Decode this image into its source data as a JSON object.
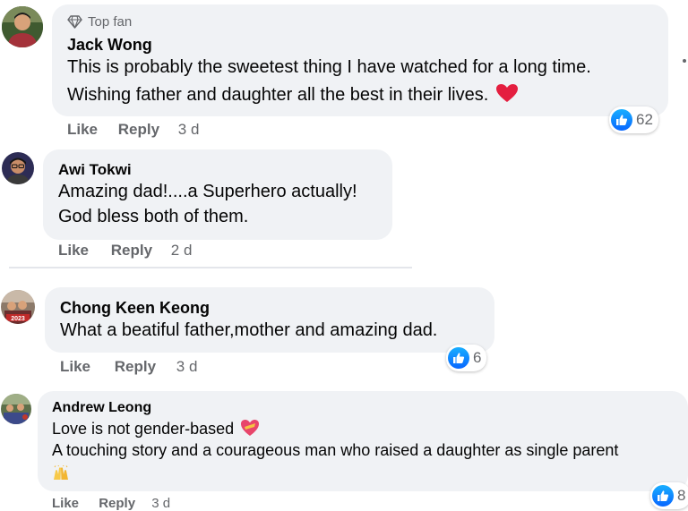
{
  "comments": [
    {
      "badge": "Top fan",
      "author": "Jack Wong",
      "lines": [
        "This is probably the sweetest thing I have watched for a long time.",
        "Wishing father and daughter all the best in their lives."
      ],
      "actions": {
        "like": "Like",
        "reply": "Reply",
        "time": "3 d"
      },
      "reactions": "62"
    },
    {
      "author": "Awi Tokwi",
      "lines": [
        "Amazing dad!....a Superhero actually!",
        "God bless both of them."
      ],
      "actions": {
        "like": "Like",
        "reply": "Reply",
        "time": "2 d"
      }
    },
    {
      "author": "Chong Keen Keong",
      "lines": [
        "What a beatiful father,mother and amazing dad."
      ],
      "actions": {
        "like": "Like",
        "reply": "Reply",
        "time": "3 d"
      },
      "reactions": "6"
    },
    {
      "author": "Andrew Leong",
      "lines": [
        "Love is not gender-based",
        "A touching story and a courageous man who raised a daughter as single parent"
      ],
      "actions": {
        "like": "Like",
        "reply": "Reply",
        "time": "3 d"
      },
      "reactions": "8"
    }
  ],
  "avatar_labels": {
    "chong": "2023"
  },
  "colors": {
    "bubble": "#f0f2f5",
    "secondary_text": "#65676b",
    "like_blue": "#0866ff",
    "heart_red": "#e41e3f"
  },
  "icons": {
    "badge": "diamond-icon",
    "reaction": "thumbs-up-icon",
    "emoji_heart": "red-heart-emoji",
    "emoji_sparkling_heart": "heart-ribbon-emoji",
    "emoji_hands": "raising-hands-emoji"
  }
}
